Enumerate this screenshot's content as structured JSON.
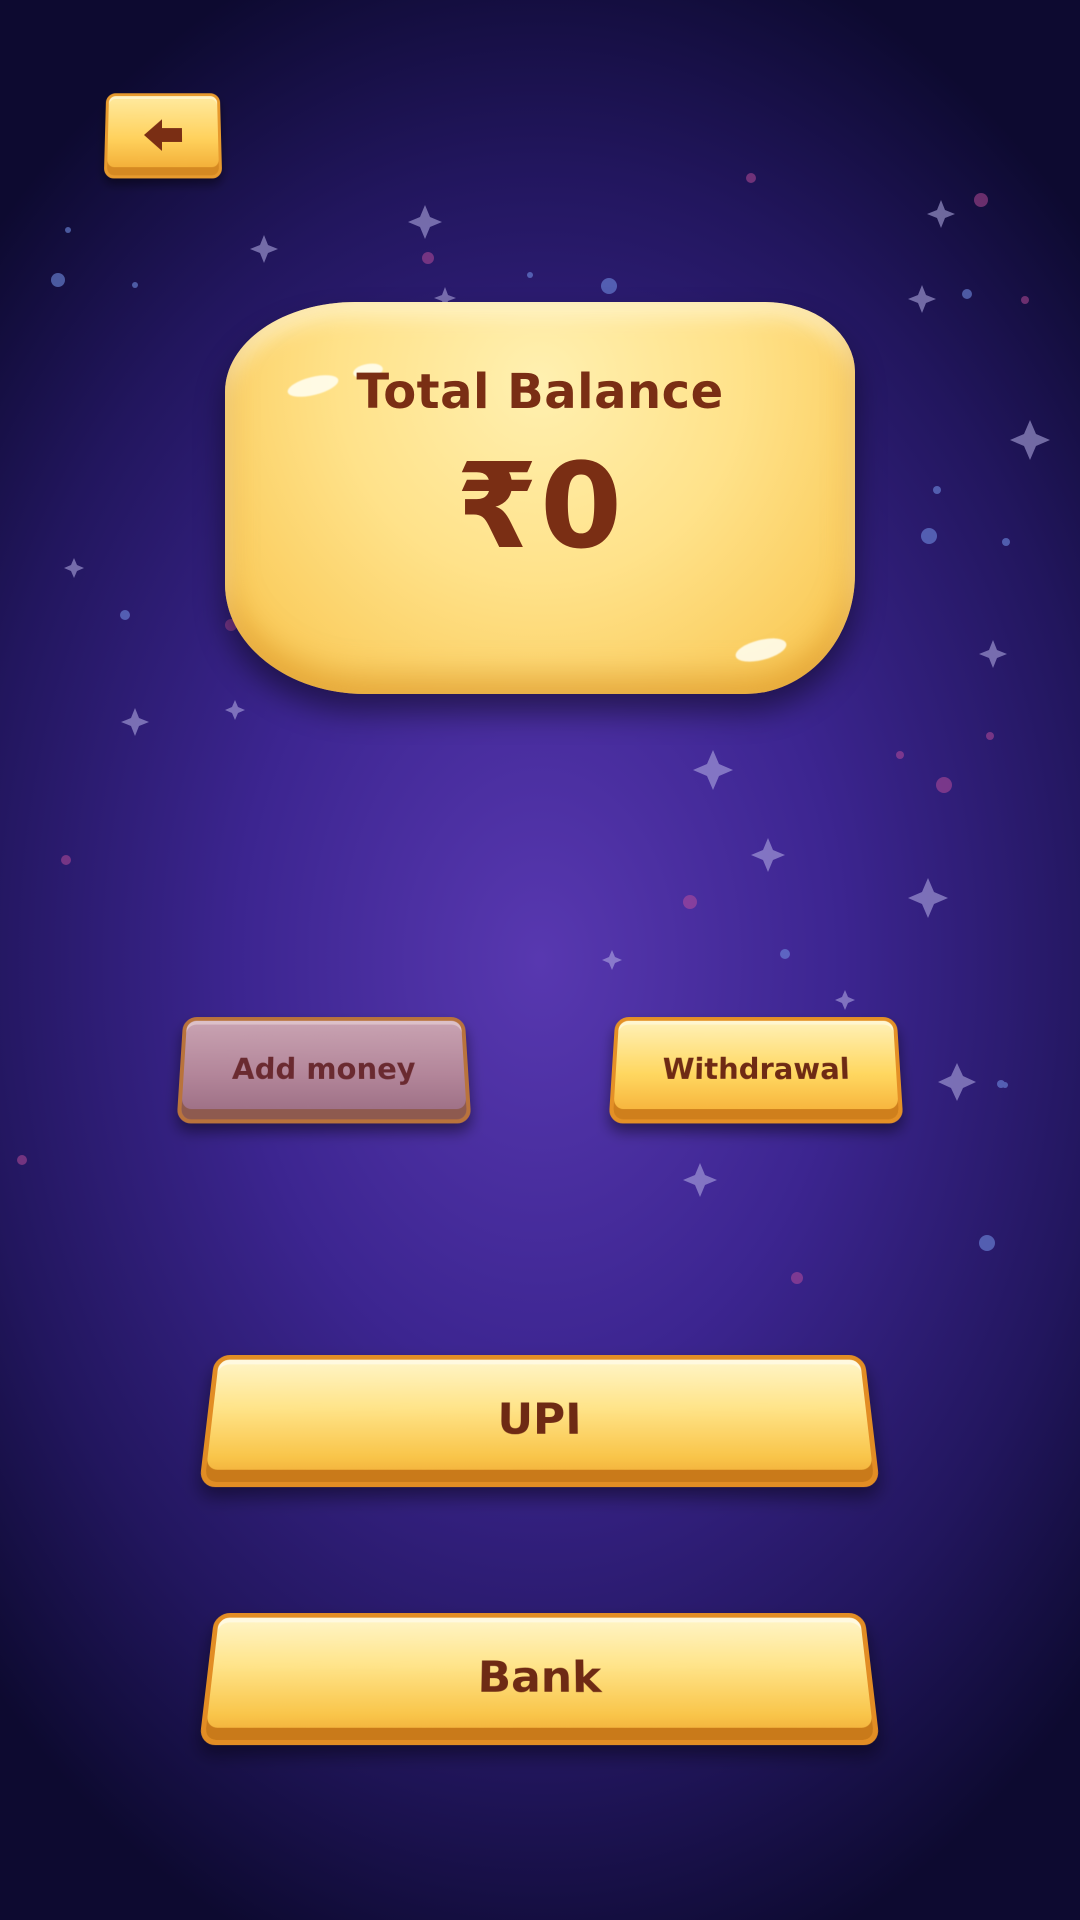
{
  "header": {
    "back_icon": "arrow-left-icon"
  },
  "balance": {
    "title": "Total Balance",
    "amount": "₹0"
  },
  "tabs": [
    {
      "label": "Add money",
      "state": "inactive"
    },
    {
      "label": "Withdrawal",
      "state": "active"
    }
  ],
  "methods": [
    {
      "label": "UPI"
    },
    {
      "label": "Bank"
    }
  ],
  "colors": {
    "background": "#3c2590",
    "button_gold": "#ffd760",
    "text_brown": "#7a2e14",
    "inactive_tab": "#b3869a"
  }
}
